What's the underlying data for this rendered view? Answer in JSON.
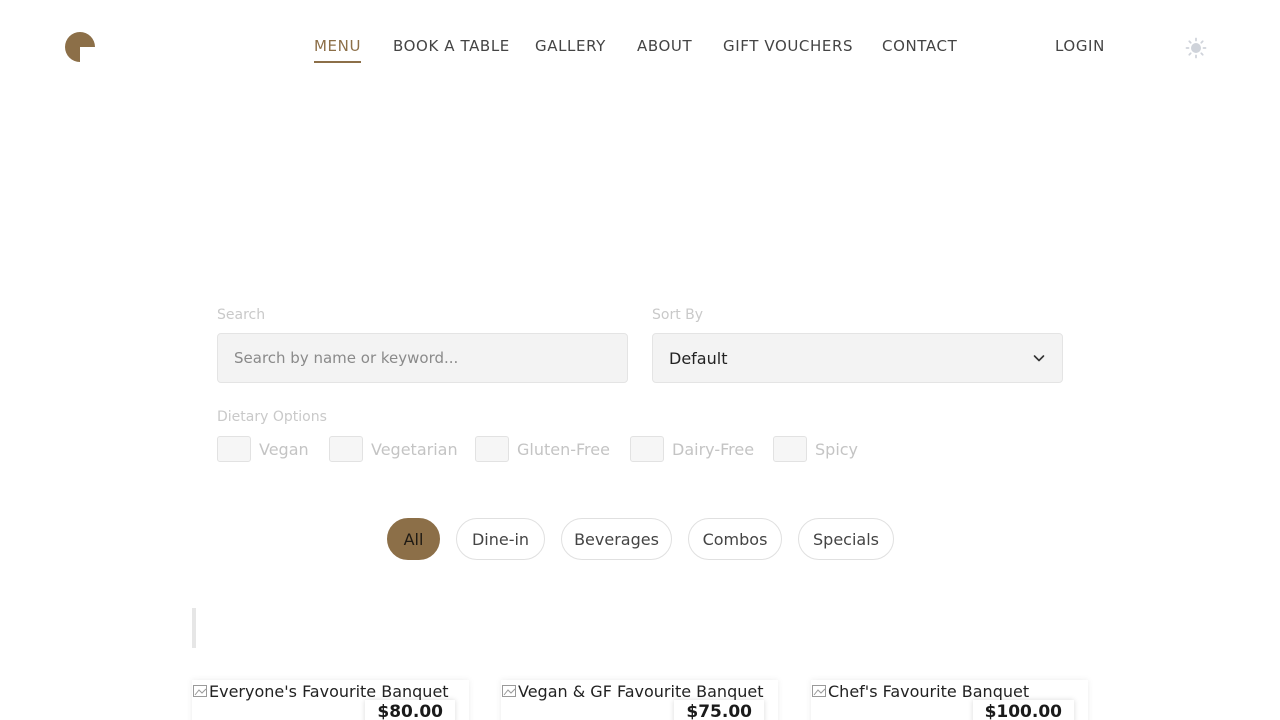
{
  "header": {
    "nav": [
      {
        "label": "MENU",
        "active": true
      },
      {
        "label": "BOOK A TABLE",
        "active": false
      },
      {
        "label": "GALLERY",
        "active": false
      },
      {
        "label": "ABOUT",
        "active": false
      },
      {
        "label": "GIFT VOUCHERS",
        "active": false
      },
      {
        "label": "CONTACT",
        "active": false
      }
    ],
    "login_label": "LOGIN",
    "logo_icon": "brand-logo-icon",
    "theme_icon": "sun-icon"
  },
  "filters": {
    "search_label": "Search",
    "search_placeholder": "Search by name or keyword...",
    "search_value": "",
    "sort_label": "Sort By",
    "sort_value": "Default",
    "dietary_label": "Dietary Options",
    "dietary": [
      {
        "label": "Vegan",
        "checked": false
      },
      {
        "label": "Vegetarian",
        "checked": false
      },
      {
        "label": "Gluten-Free",
        "checked": false
      },
      {
        "label": "Dairy-Free",
        "checked": false
      },
      {
        "label": "Spicy",
        "checked": false
      }
    ]
  },
  "categories": [
    {
      "label": "All",
      "active": true
    },
    {
      "label": "Dine-in",
      "active": false
    },
    {
      "label": "Beverages",
      "active": false
    },
    {
      "label": "Combos",
      "active": false
    },
    {
      "label": "Specials",
      "active": false
    }
  ],
  "cards": [
    {
      "title": "Everyone's Favourite Banquet",
      "price": "$80.00"
    },
    {
      "title": "Vegan & GF Favourite Banquet",
      "price": "$75.00"
    },
    {
      "title": "Chef's Favourite Banquet",
      "price": "$100.00"
    }
  ],
  "colors": {
    "accent": "#8c6f48"
  }
}
